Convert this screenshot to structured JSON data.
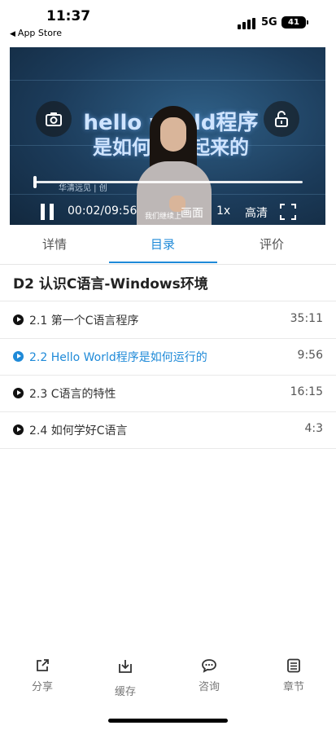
{
  "status_bar": {
    "time": "11:37",
    "back_label": "App Store",
    "network": "5G",
    "battery": "41"
  },
  "video": {
    "title_line1": "hello world程序",
    "title_line2": "是如何运行起来的",
    "watermark": "华清远见 | 创",
    "time_display": "00:02/09:56",
    "subtitle": "我们继续上",
    "picture_label": "画面",
    "speed_label": "1x",
    "quality_label": "高清",
    "progress": 0.003
  },
  "tabs": [
    {
      "label": "详情"
    },
    {
      "label": "目录",
      "active": true
    },
    {
      "label": "评价"
    }
  ],
  "chapter": {
    "title": "D2  认识C语言-Windows环境",
    "lessons": [
      {
        "title": "2.1 第一个C语言程序",
        "duration": "35:11",
        "active": false
      },
      {
        "title": "2.2 Hello World程序是如何运行的",
        "duration": "9:56",
        "active": true
      },
      {
        "title": "2.3 C语言的特性",
        "duration": "16:15",
        "active": false
      },
      {
        "title": "2.4 如何学好C语言",
        "duration": "4:3",
        "active": false
      }
    ]
  },
  "bottom_bar": [
    {
      "label": "分享",
      "icon": "share-icon"
    },
    {
      "label": "缓存",
      "icon": "download-icon"
    },
    {
      "label": "咨询",
      "icon": "chat-icon"
    },
    {
      "label": "章节",
      "icon": "list-icon"
    }
  ],
  "colors": {
    "accent": "#1f8ad8"
  }
}
